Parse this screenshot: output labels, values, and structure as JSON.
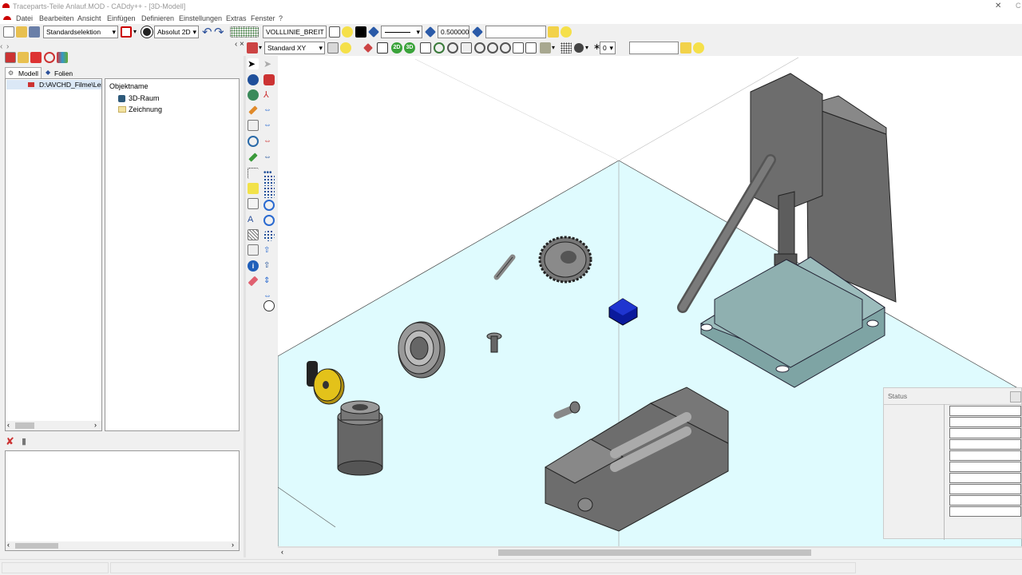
{
  "window": {
    "title": "Traceparts-Teile Anlauf.MOD - CADdy++ - [3D-Modell]",
    "edge_letter": "C",
    "close": "✕"
  },
  "menu": [
    "Datei",
    "Bearbeiten",
    "Ansicht",
    "Einfügen",
    "Definieren",
    "Einstellungen",
    "Extras",
    "Fenster",
    "?"
  ],
  "toolbar1": {
    "selection": "Standardselektion",
    "coord_mode": "Absolut 2D",
    "line_type": "VOLLLINIE_BREIT",
    "line_width": "0.500000",
    "value_field": ""
  },
  "toolbar2": {
    "view": "Standard XY",
    "btn_2d": "2D",
    "btn_3d": "3D",
    "counter": "0",
    "value_field": ""
  },
  "left_panel": {
    "tabs": [
      "Modell",
      "Folien"
    ],
    "tree_item": "D:\\AVCHD_Filme\\Lern",
    "column_header": "Objektname",
    "objects": [
      "3D-Raum",
      "Zeichnung"
    ]
  },
  "status_panel": {
    "title": "Status"
  },
  "colors": {
    "floor": "#dffbfe",
    "part_gray": "#6d6d6d",
    "base_teal": "#7ea4a4",
    "component_blue": "#0a1a9c",
    "accent_yellow": "#e3c21a"
  }
}
